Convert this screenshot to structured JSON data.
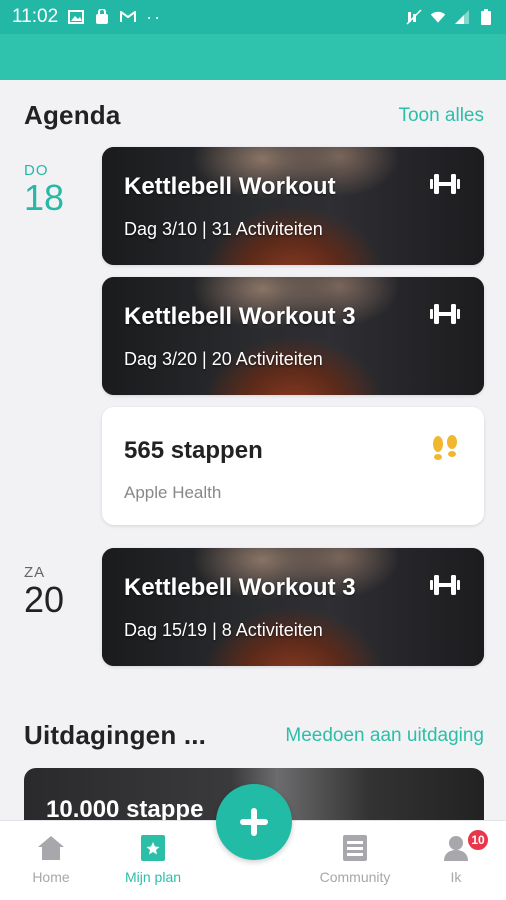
{
  "status_bar": {
    "time": "11:02",
    "dots": "··"
  },
  "agenda": {
    "title": "Agenda",
    "show_all": "Toon alles",
    "days": [
      {
        "abbr": "DO",
        "num": "18",
        "items": [
          {
            "type": "workout",
            "title": "Kettlebell Workout",
            "subtitle": "Dag 3/10 | 31 Activiteiten",
            "icon": "dumbbell-icon"
          },
          {
            "type": "workout",
            "title": "Kettlebell Workout 3",
            "subtitle": "Dag 3/20 | 20 Activiteiten",
            "icon": "dumbbell-icon"
          },
          {
            "type": "steps",
            "title": "565 stappen",
            "subtitle": "Apple Health",
            "icon": "footsteps-icon"
          }
        ]
      },
      {
        "abbr": "ZA",
        "num": "20",
        "items": [
          {
            "type": "workout",
            "title": "Kettlebell Workout 3",
            "subtitle": "Dag 15/19 | 8 Activiteiten",
            "icon": "dumbbell-icon"
          }
        ]
      }
    ]
  },
  "challenges": {
    "title": "Uitdagingen ...",
    "join_link": "Meedoen aan uitdaging",
    "card_title": "10.000 stappe"
  },
  "bottom_nav": {
    "items": [
      {
        "label": "Home",
        "icon": "home-icon"
      },
      {
        "label": "Mijn plan",
        "icon": "plan-star-icon"
      },
      {
        "label": "Community",
        "icon": "community-icon"
      },
      {
        "label": "Ik",
        "icon": "profile-icon"
      }
    ],
    "badge": "10",
    "active": "Mijn plan"
  },
  "colors": {
    "accent": "#2bbfa8",
    "header": "#2fc2ad",
    "badge": "#e8374a",
    "steps_icon": "#f0b72f"
  }
}
